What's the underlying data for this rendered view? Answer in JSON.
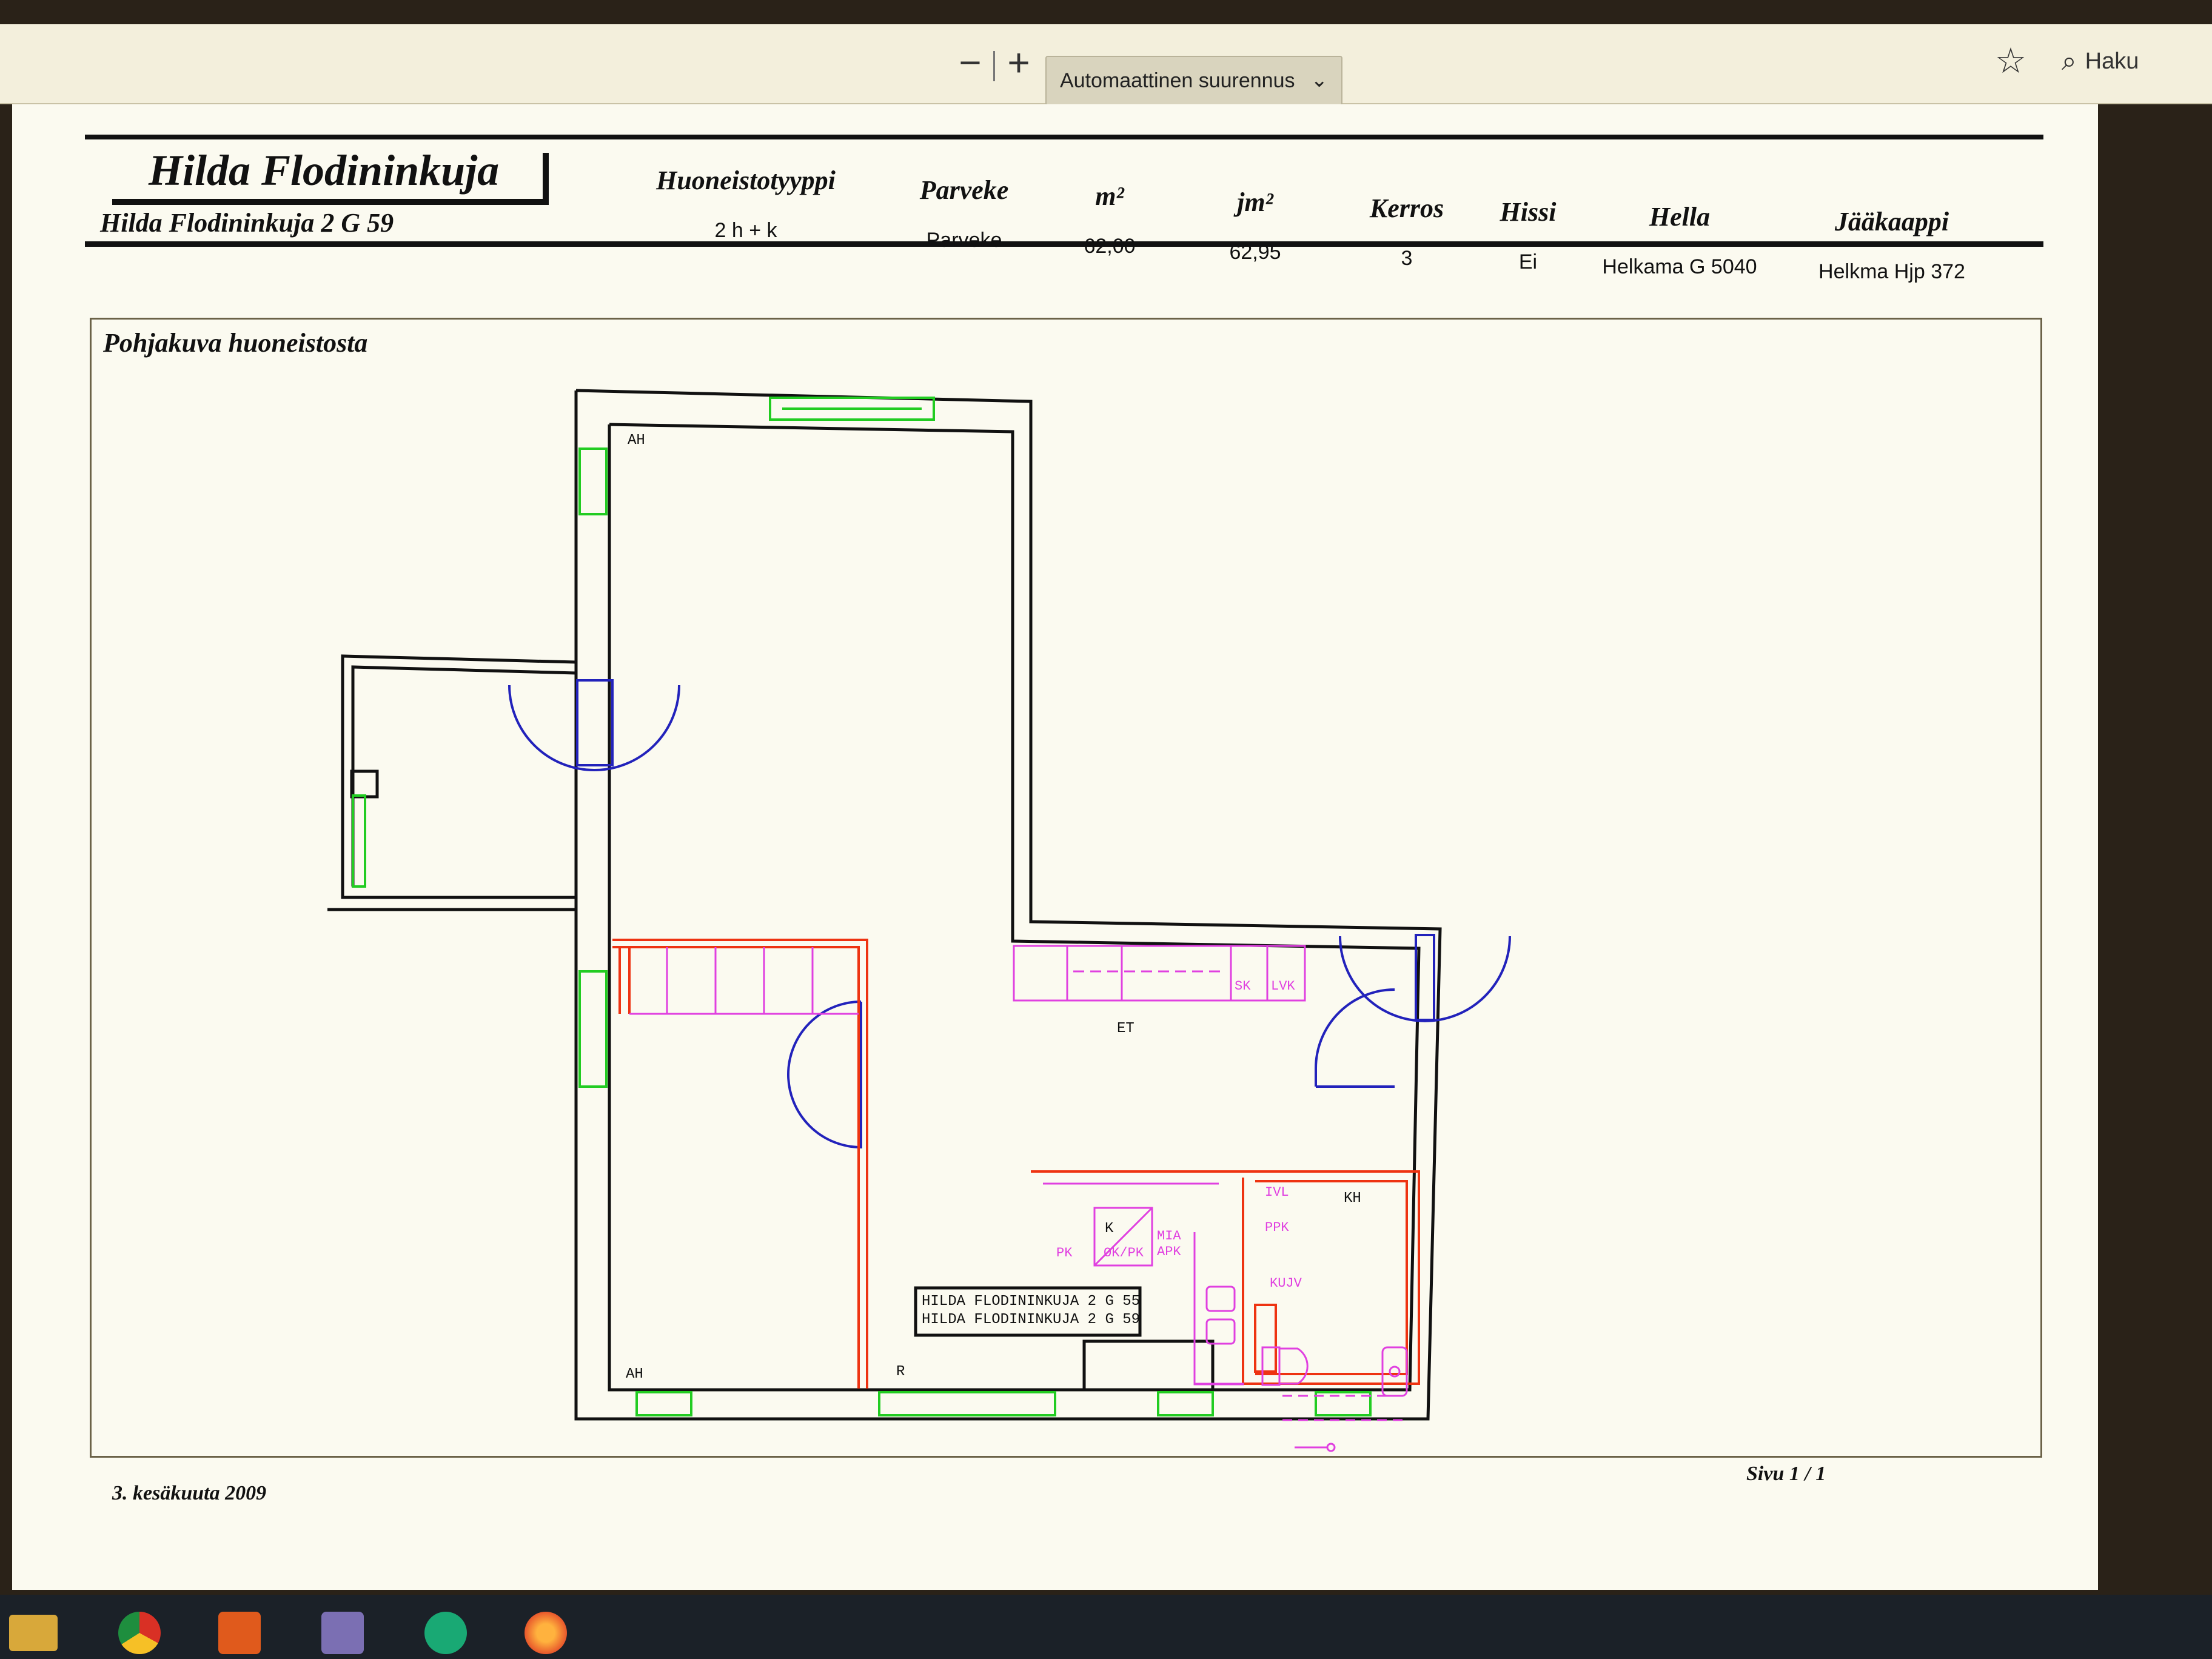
{
  "viewer": {
    "zoom_out_label": "−",
    "zoom_in_label": "+",
    "zoom_mode": "Automaattinen suurennus",
    "search_label": "Haku"
  },
  "header": {
    "title": "Hilda Flodininkuja",
    "address": "Hilda Flodininkuja 2    G  59",
    "columns": [
      {
        "label": "Huoneistotyyppi",
        "value": "2 h + k"
      },
      {
        "label": "Parveke",
        "value": "Parveke"
      },
      {
        "label": "m²",
        "value": "62,00"
      },
      {
        "label": "jm²",
        "value": "62,95"
      },
      {
        "label": "Kerros",
        "value": "3"
      },
      {
        "label": "Hissi",
        "value": "Ei"
      },
      {
        "label": "Hella",
        "value": "Helkama G 5040"
      },
      {
        "label": "Jääkaappi",
        "value": "Helkma Hjp 372"
      }
    ]
  },
  "plan": {
    "title": "Pohjakuva huoneistosta",
    "labels": {
      "ah_top": "AH",
      "ah_bottom": "AH",
      "r": "R",
      "et": "ET",
      "k": "K",
      "kh": "KH",
      "sk": "SK",
      "lvk": "LVK",
      "pk": "PK",
      "ok_pk": "OK/PK",
      "mia": "MIA",
      "apk": "APK",
      "ivl": "IVL",
      "ppk": "PPK",
      "kujv": "KUJV"
    },
    "stamp": [
      "HILDA FLODININKUJA 2 G 55",
      "HILDA FLODININKUJA 2 G 59"
    ],
    "colors": {
      "wall": "#111111",
      "window": "#22cc22",
      "door": "#2222bb",
      "fixture": "#e040e0",
      "red": "#ee3311"
    }
  },
  "footer": {
    "date": "3. kesäkuuta 2009",
    "page": "Sivu 1 / 1"
  },
  "taskbar": {
    "apps": [
      "file-explorer-icon",
      "chrome-icon",
      "media-player-icon",
      "mail-app-icon",
      "at-sign-app-icon",
      "firefox-icon"
    ]
  }
}
